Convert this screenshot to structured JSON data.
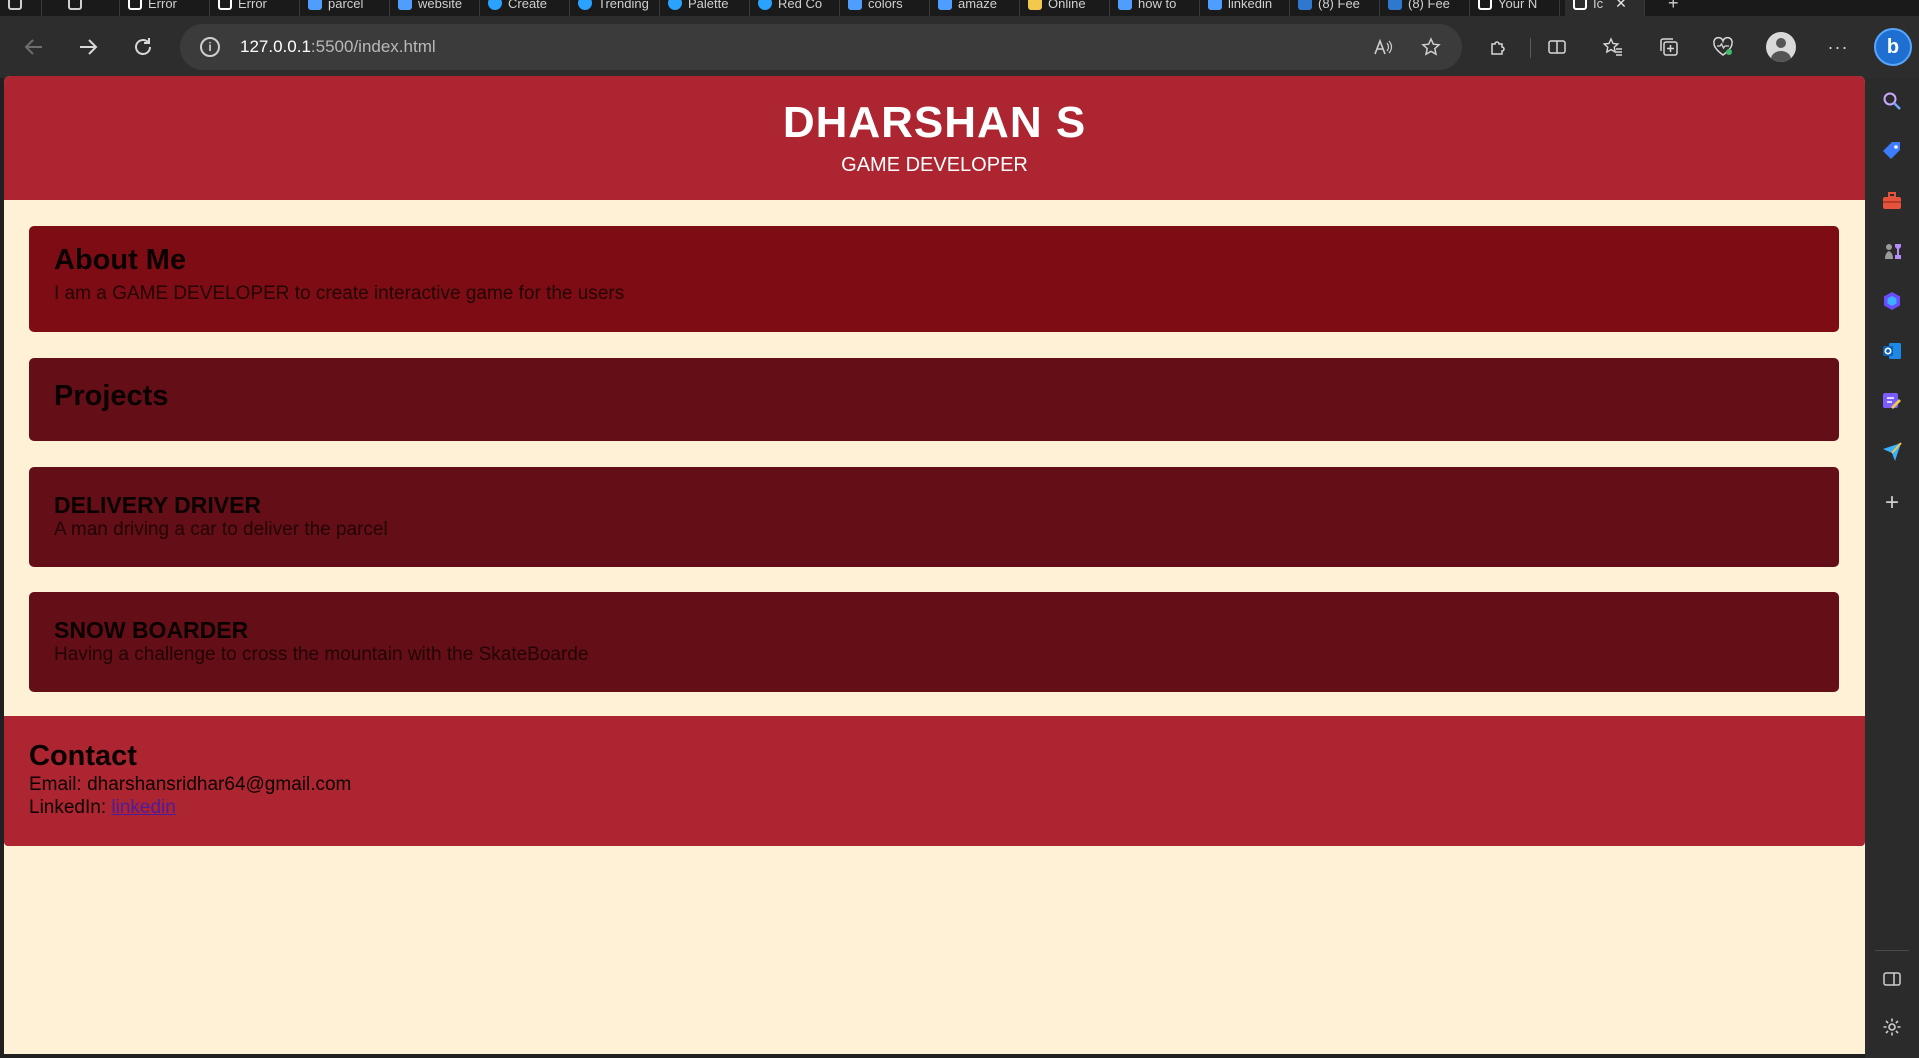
{
  "browser": {
    "tabs": [
      {
        "label": "Error",
        "color": "#ffffff"
      },
      {
        "label": "Error",
        "color": "#ffffff"
      },
      {
        "label": "parcel",
        "color": "#4f9dff"
      },
      {
        "label": "website",
        "color": "#4f9dff"
      },
      {
        "label": "Create",
        "color": "#29a3ff"
      },
      {
        "label": "Trending",
        "color": "#29a3ff"
      },
      {
        "label": "Palette",
        "color": "#29a3ff"
      },
      {
        "label": "Red Co",
        "color": "#29a3ff"
      },
      {
        "label": "colors",
        "color": "#4f9dff"
      },
      {
        "label": "amaze",
        "color": "#4f9dff"
      },
      {
        "label": "Online",
        "color": "#f2c94c"
      },
      {
        "label": "how to",
        "color": "#4f9dff"
      },
      {
        "label": "linkedin",
        "color": "#4f9dff"
      },
      {
        "label": "(8) Fee",
        "color": "#2f78d0"
      },
      {
        "label": "(8) Fee",
        "color": "#2f78d0"
      },
      {
        "label": "Your N",
        "color": "#ffffff"
      },
      {
        "label": "Ic",
        "color": "#ffffff"
      }
    ],
    "new_tab_symbol": "+",
    "close_symbol": "✕",
    "url_host": "127.0.0.1",
    "url_rest": ":5500/index.html",
    "more_symbol": "···",
    "bing_label": "b"
  },
  "page": {
    "header": {
      "name": "DHARSHAN S",
      "role": "GAME DEVELOPER"
    },
    "about": {
      "title": "About Me",
      "text": "I am a GAME DEVELOPER to create interactive game for the users"
    },
    "projects": {
      "title": "Projects",
      "items": [
        {
          "title": "DELIVERY DRIVER",
          "description": "A man driving a car to deliver the parcel"
        },
        {
          "title": "SNOW BOARDER",
          "description": "Having a challenge to cross the mountain with the SkateBoarde"
        }
      ]
    },
    "contact": {
      "title": "Contact",
      "email_label": "Email:",
      "email": "dharshansridhar64@gmail.com",
      "linkedin_label": "LinkedIn:",
      "linkedin_text": "linkedin"
    }
  },
  "colors": {
    "page_background": "#fff1d6",
    "header_background": "#ad2530",
    "about_card": "#7e0c14",
    "project_cards": "#640e17",
    "contact_background": "#ad2530"
  }
}
